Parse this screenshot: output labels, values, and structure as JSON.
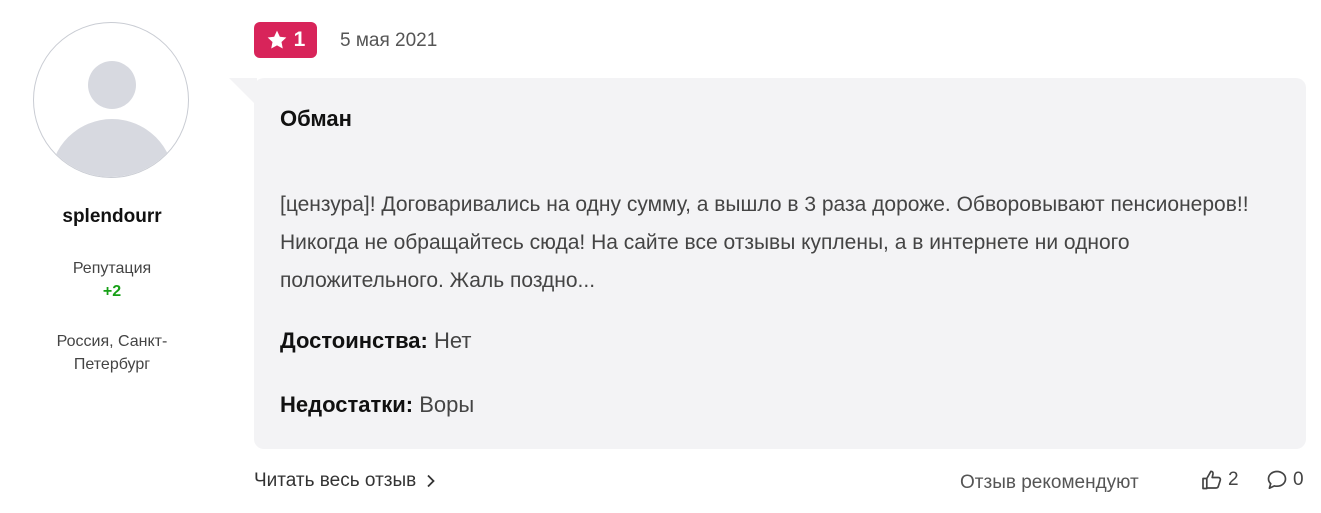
{
  "author": {
    "username": "splendourr",
    "reputation_label": "Репутация",
    "reputation_value": "+2",
    "location": "Россия, Санкт-Петербург",
    "avatar_icon": "default-user-avatar"
  },
  "review": {
    "rating": "1",
    "rating_color": "#d8245a",
    "date": "5 мая 2021",
    "title": "Обман",
    "text": "[цензура]! Договаривались на одну сумму, а вышло в 3 раза дороже. Обворовывают пенсионеров!! Никогда не обращайтесь сюда! На сайте все отзывы куплены, а в интернете ни одного положительного. Жаль поздно...",
    "pros_label": "Достоинства:",
    "pros_value": "Нет",
    "cons_label": "Недостатки:",
    "cons_value": "Воры"
  },
  "footer": {
    "read_more": "Читать весь отзыв",
    "recommend_label": "Отзыв рекомендуют",
    "likes_count": "2",
    "comments_count": "0"
  }
}
